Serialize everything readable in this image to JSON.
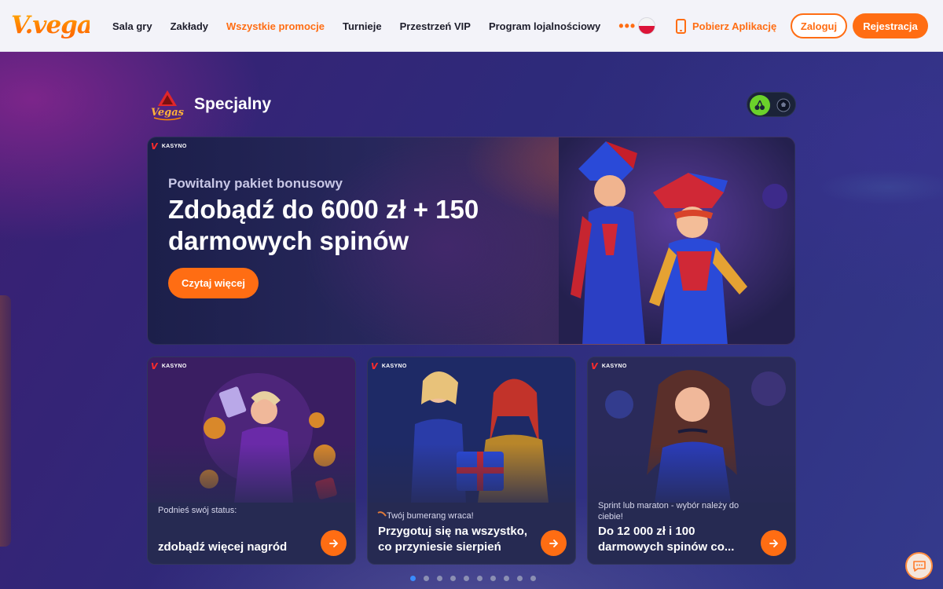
{
  "brand": {
    "logo_text": "V.vegas"
  },
  "nav": {
    "items": [
      {
        "label": "Sala gry",
        "active": false
      },
      {
        "label": "Zakłady",
        "active": false
      },
      {
        "label": "Wszystkie promocje",
        "active": true
      },
      {
        "label": "Turnieje",
        "active": false
      },
      {
        "label": "Przestrzeń VIP",
        "active": false
      },
      {
        "label": "Program lojalnościowy",
        "active": false
      }
    ],
    "more_label": "•••"
  },
  "header": {
    "language": "pl",
    "download_app_label": "Pobierz Aplikację",
    "login_label": "Zaloguj",
    "register_label": "Rejestracja"
  },
  "section": {
    "logo_text": "Vegas",
    "title": "Specjalny",
    "toggle": {
      "selected": "casino",
      "options": [
        "casino",
        "sport"
      ]
    }
  },
  "hero": {
    "badge": "KASYNO",
    "subtitle": "Powitalny pakiet bonusowy",
    "title": "Zdobądź do 6000 zł + 150 darmowych spinów",
    "button_label": "Czytaj więcej"
  },
  "cards": [
    {
      "badge": "KASYNO",
      "small": "Podnieś swój status:",
      "big": "zdobądź więcej nagród"
    },
    {
      "badge": "KASYNO",
      "small": "Twój bumerang wraca!",
      "big": "Przygotuj się na wszystko, co przyniesie sierpień"
    },
    {
      "badge": "KASYNO",
      "small": "Sprint lub maraton - wybór należy do ciebie!",
      "big": "Do 12 000 zł i 100 darmowych spinów co..."
    }
  ],
  "pagination": {
    "total": 10,
    "current": 1
  },
  "colors": {
    "accent": "#ff6d13",
    "header_bg": "#f3f3f9",
    "toggle_active": "#6bd12b",
    "dot_active": "#3a8cff"
  }
}
